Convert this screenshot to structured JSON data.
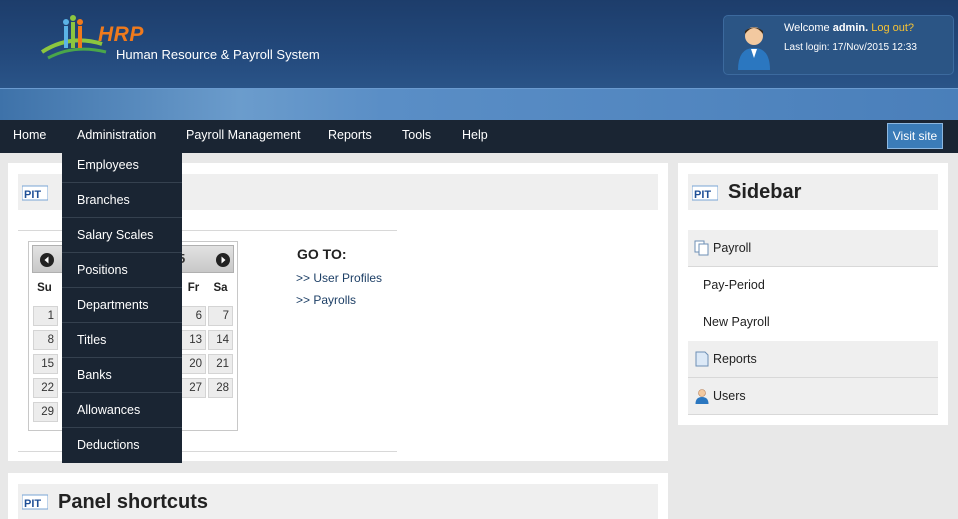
{
  "header": {
    "logo_title": "HRP",
    "logo_subtitle": "Human Resource & Payroll System",
    "welcome_prefix": "Welcome",
    "username": "admin.",
    "logout_label": "Log out?",
    "last_login": "Last login: 17/Nov/2015 12:33"
  },
  "nav": {
    "items": [
      "Home",
      "Administration",
      "Payroll Management",
      "Reports",
      "Tools",
      "Help"
    ],
    "visit_site": "Visit site"
  },
  "admin_menu": {
    "items": [
      "Employees",
      "Branches",
      "Salary Scales",
      "Positions",
      "Departments",
      "Titles",
      "Banks",
      "Allowances",
      "Deductions"
    ]
  },
  "calendar": {
    "title_visible": "5",
    "weekdays": [
      "Su",
      "Fr",
      "Sa"
    ],
    "sunday_days": [
      "1",
      "8",
      "15",
      "22",
      "29"
    ],
    "friday_days": [
      "6",
      "13",
      "20",
      "27"
    ],
    "saturday_days": [
      "7",
      "14",
      "21",
      "28"
    ]
  },
  "goto": {
    "heading": "GO TO:",
    "links": [
      ">> User Profiles",
      ">> Payrolls"
    ]
  },
  "sidebar": {
    "title": "Sidebar",
    "items": [
      "Payroll",
      "Pay-Period",
      "New Payroll",
      "Reports",
      "Users"
    ]
  },
  "shortcuts": {
    "title": "Panel shortcuts"
  },
  "colors": {
    "header_bg": "#1d3d6b",
    "nav_bg": "#1a2533",
    "accent": "#f07a1c",
    "logout": "#f6c233"
  }
}
